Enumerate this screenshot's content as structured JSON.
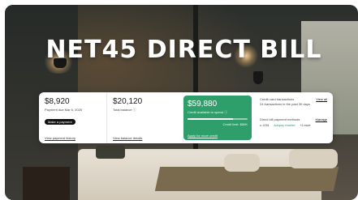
{
  "headline": "NET45 DIRECT BILL",
  "summary_card": {
    "payment": {
      "amount": "$8,920",
      "due": "Payment due Mar 6, 2025",
      "button": "Make a payment",
      "link": "View payment history"
    },
    "balance": {
      "amount": "$20,120",
      "label": "Total balance",
      "link": "View balance details"
    },
    "credit": {
      "amount": "$59,880",
      "label": "Credit available to spend",
      "limit": "Credit limit: $80K",
      "link": "Apply for more credit",
      "progress_fraction": 0.75,
      "color": "#2e9e6a"
    },
    "transactions": {
      "label": "Credit card transactions",
      "action": "View all",
      "detail": "24 transactions in the past 30 days"
    },
    "methods": {
      "label": "Direct bill payment methods",
      "action": "Manage",
      "items": [
        "•• 1234",
        "Autopay enabled",
        "+1 more"
      ]
    }
  }
}
